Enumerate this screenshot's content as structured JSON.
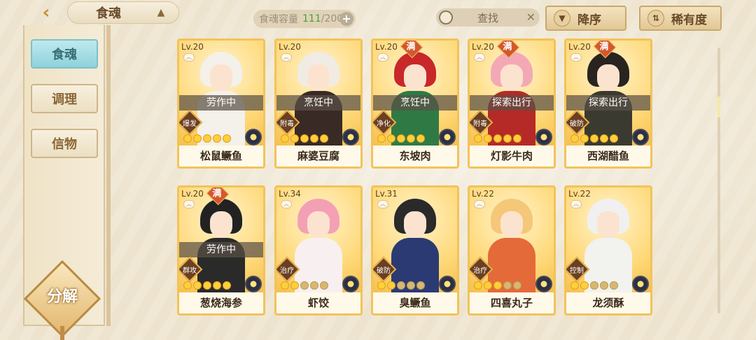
{
  "header": {
    "title": "食魂",
    "capacity_label": "食魂容量",
    "capacity_current": "111",
    "capacity_total": "/200",
    "search_placeholder": "查找",
    "sort_label": "降序",
    "rarity_label": "稀有度"
  },
  "sidebar": {
    "items": [
      {
        "label": "食魂",
        "active": true
      },
      {
        "label": "调理",
        "active": false
      },
      {
        "label": "信物",
        "active": false
      }
    ],
    "decompose_label": "分解"
  },
  "colors": {
    "accent": "#f2c35a",
    "active_tab": "#8ed2dc",
    "status_bg": "#5a5046",
    "full_badge": "#d4572e"
  },
  "cards": [
    {
      "level": "Lv.20",
      "name": "松鼠鳜鱼",
      "status": "劳作中",
      "type": "爆发",
      "stars": 5,
      "full": false,
      "hair": "#f4f0ea",
      "outfit": "#f4f0ea"
    },
    {
      "level": "Lv.20",
      "name": "麻婆豆腐",
      "status": "烹饪中",
      "type": "附毒",
      "stars": 5,
      "full": false,
      "hair": "#f0ece4",
      "outfit": "#3a2a26"
    },
    {
      "level": "Lv.20",
      "name": "东坡肉",
      "status": "烹饪中",
      "type": "净化",
      "stars": 5,
      "full": true,
      "hair": "#c8282a",
      "outfit": "#2f7a44"
    },
    {
      "level": "Lv.20",
      "name": "灯影牛肉",
      "status": "探索出行",
      "type": "附毒",
      "stars": 5,
      "full": true,
      "hair": "#f4a8b6",
      "outfit": "#b52a26"
    },
    {
      "level": "Lv.20",
      "name": "西湖醋鱼",
      "status": "探索出行",
      "type": "破防",
      "stars": 5,
      "full": true,
      "hair": "#2a2420",
      "outfit": "#3a3a30"
    },
    {
      "level": "Lv.20",
      "name": "葱烧海参",
      "status": "劳作中",
      "type": "群攻",
      "stars": 5,
      "full": true,
      "hair": "#222222",
      "outfit": "#2a2a2a"
    },
    {
      "level": "Lv.34",
      "name": "虾饺",
      "status": "",
      "type": "治疗",
      "stars": 2,
      "full": false,
      "hair": "#f4a0b4",
      "outfit": "#f8f0f0"
    },
    {
      "level": "Lv.31",
      "name": "臭鳜鱼",
      "status": "",
      "type": "破防",
      "stars": 2,
      "full": false,
      "hair": "#2a2a2a",
      "outfit": "#2c3a74"
    },
    {
      "level": "Lv.22",
      "name": "四喜丸子",
      "status": "",
      "type": "治疗",
      "stars": 3,
      "full": false,
      "hair": "#f4c878",
      "outfit": "#e46a3a"
    },
    {
      "level": "Lv.22",
      "name": "龙须酥",
      "status": "",
      "type": "控制",
      "stars": 2,
      "full": false,
      "hair": "#f0f0f0",
      "outfit": "#f2f2ee"
    }
  ]
}
